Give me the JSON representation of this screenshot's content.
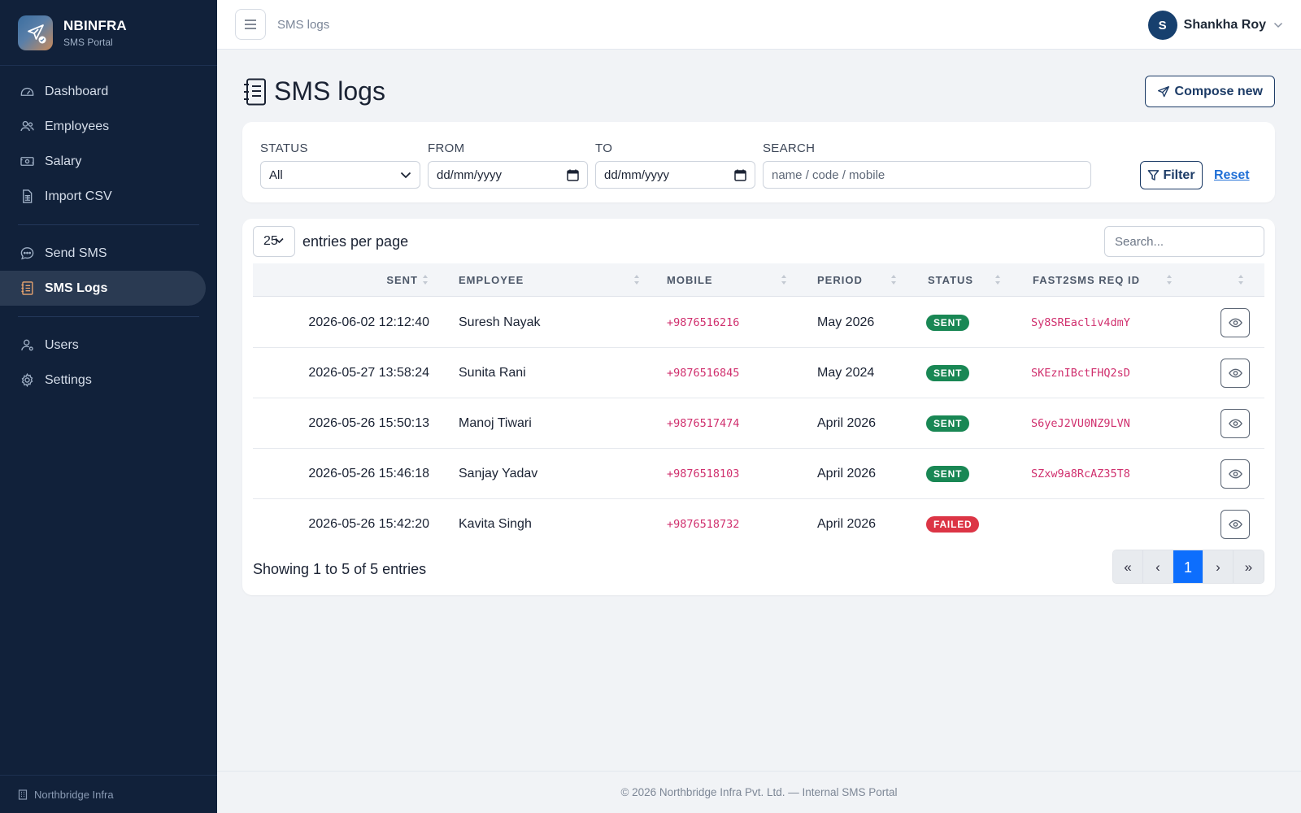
{
  "brand": {
    "name": "NBINFRA",
    "subtitle": "SMS Portal"
  },
  "sidebar": {
    "items": [
      {
        "label": "Dashboard",
        "icon": "dashboard-icon"
      },
      {
        "label": "Employees",
        "icon": "people-icon"
      },
      {
        "label": "Salary",
        "icon": "cash-icon"
      },
      {
        "label": "Import CSV",
        "icon": "spreadsheet-icon"
      },
      {
        "label": "Send SMS",
        "icon": "chat-dots-icon"
      },
      {
        "label": "SMS Logs",
        "icon": "journal-icon",
        "active": true
      },
      {
        "label": "Users",
        "icon": "user-icon"
      },
      {
        "label": "Settings",
        "icon": "gear-icon"
      }
    ],
    "footer": "Northbridge Infra"
  },
  "topbar": {
    "breadcrumb": "SMS logs",
    "user": {
      "initial": "S",
      "name": "Shankha Roy"
    }
  },
  "page": {
    "title": "SMS logs",
    "compose_label": "Compose new"
  },
  "filters": {
    "status_label": "STATUS",
    "status_value": "All",
    "from_label": "FROM",
    "from_value": "dd/mm/yyyy",
    "to_label": "TO",
    "to_value": "dd/mm/yyyy",
    "search_label": "SEARCH",
    "search_placeholder": "name / code / mobile",
    "filter_button": "Filter",
    "reset_link": "Reset"
  },
  "table": {
    "per_page_value": "25",
    "per_page_text": "entries per page",
    "search_placeholder": "Search...",
    "columns": [
      "SENT",
      "EMPLOYEE",
      "MOBILE",
      "PERIOD",
      "STATUS",
      "FAST2SMS REQ ID"
    ],
    "rows": [
      {
        "sent": "2026-06-02 12:12:40",
        "employee": "Suresh Nayak",
        "mobile": "+9876516216",
        "period": "May 2026",
        "status": "SENT",
        "req_id": "Sy8SREacliv4dmY"
      },
      {
        "sent": "2026-05-27 13:58:24",
        "employee": "Sunita Rani",
        "mobile": "+9876516845",
        "period": "May 2024",
        "status": "SENT",
        "req_id": "SKEznIBctFHQ2sD"
      },
      {
        "sent": "2026-05-26 15:50:13",
        "employee": "Manoj Tiwari",
        "mobile": "+9876517474",
        "period": "April 2026",
        "status": "SENT",
        "req_id": "S6yeJ2VU0NZ9LVN"
      },
      {
        "sent": "2026-05-26 15:46:18",
        "employee": "Sanjay Yadav",
        "mobile": "+9876518103",
        "period": "April 2026",
        "status": "SENT",
        "req_id": "SZxw9a8RcAZ35T8"
      },
      {
        "sent": "2026-05-26 15:42:20",
        "employee": "Kavita Singh",
        "mobile": "+9876518732",
        "period": "April 2026",
        "status": "FAILED",
        "req_id": ""
      }
    ],
    "showing": "Showing 1 to 5 of 5 entries",
    "pagination": {
      "first": "«",
      "prev": "‹",
      "current": "1",
      "next": "›",
      "last": "»"
    }
  },
  "footer": "© 2026 Northbridge Infra Pvt. Ltd. — Internal SMS Portal",
  "colors": {
    "sidebar_bg": "#11213a",
    "sent_badge": "#198754",
    "failed_badge": "#dc3545",
    "mono_text": "#d0306e",
    "accent": "#0d6efd"
  }
}
